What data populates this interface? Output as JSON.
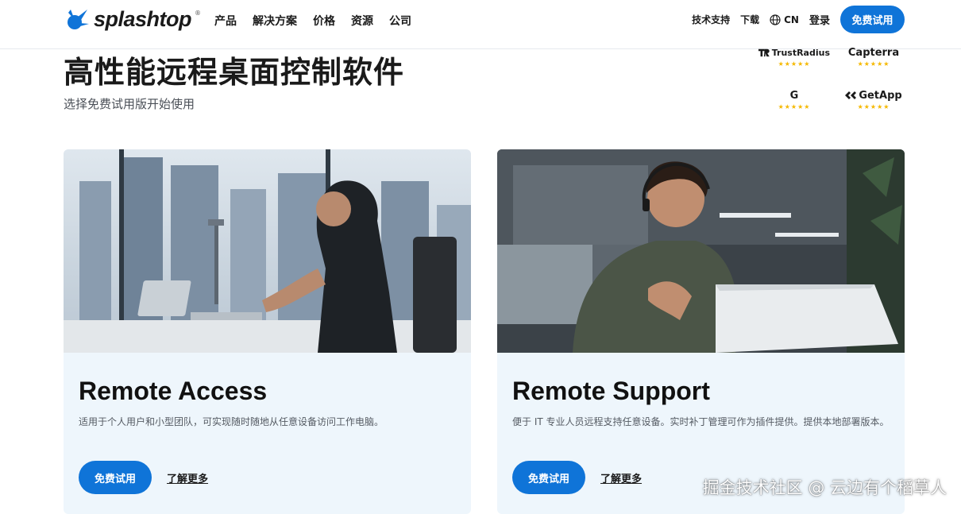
{
  "header": {
    "logo_text": "splashtop",
    "logo_mark": "®",
    "nav": [
      "产品",
      "解决方案",
      "价格",
      "资源",
      "公司"
    ],
    "support_label": "技术支持",
    "download_label": "下载",
    "language_label": "CN",
    "login_label": "登录",
    "trial_button": "免费试用"
  },
  "hero": {
    "title": "高性能远程桌面控制软件",
    "subtitle": "选择免费试用版开始使用"
  },
  "ratings": [
    {
      "name": "TrustRadius",
      "icon": "trustradius-logo",
      "stars": "★★★★★"
    },
    {
      "name": "Capterra",
      "icon": "capterra-logo",
      "stars": "★★★★★"
    },
    {
      "name": "G",
      "icon": "g2-logo",
      "stars": "★★★★★"
    },
    {
      "name": "GetApp",
      "icon": "getapp-logo",
      "stars": "★★★★★"
    }
  ],
  "cards": [
    {
      "title": "Remote Access",
      "description": "适用于个人用户和小型团队，可实现随时随地从任意设备访问工作电脑。",
      "button": "免费试用",
      "link": "了解更多"
    },
    {
      "title": "Remote Support",
      "description": "便于 IT 专业人员远程支持任意设备。实时补丁管理可作为插件提供。提供本地部署版本。",
      "button": "免费试用",
      "link": "了解更多"
    }
  ],
  "watermark": "掘金技术社区 @ 云边有个稻草人",
  "colors": {
    "accent": "#0f74d8",
    "card_bg": "#eef6fc",
    "star": "#f5b800"
  }
}
